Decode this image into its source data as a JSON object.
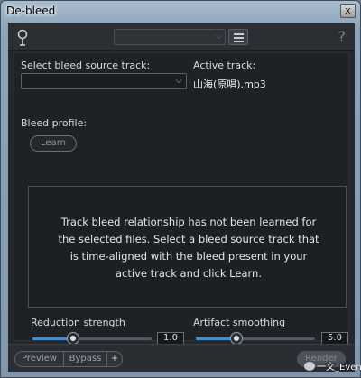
{
  "window": {
    "title": "De-bleed",
    "close_glyph": "x"
  },
  "topbar": {
    "plugin_icon": "microphone-icon",
    "preset_value": "",
    "menu_icon": "hamburger-icon",
    "help_glyph": "?"
  },
  "source": {
    "label": "Select bleed source track:",
    "value": ""
  },
  "active": {
    "label": "Active track:",
    "value": "山海(原唱).mp3"
  },
  "profile": {
    "label": "Bleed profile:",
    "learn_label": "Learn"
  },
  "info": {
    "message": "Track bleed relationship has not been learned for the selected files. Select a bleed source track that is time-aligned with the bleed present in your active track and click Learn."
  },
  "reduction": {
    "label": "Reduction strength",
    "value": "1.0",
    "level": 0.34
  },
  "artifact": {
    "label": "Artifact smoothing",
    "value": "5.0",
    "level": 0.34
  },
  "bottombar": {
    "preview_label": "Preview",
    "bypass_label": "Bypass",
    "add_label": "+",
    "render_label": "Render"
  },
  "watermark": {
    "text": "一文_Even"
  },
  "colors": {
    "accent": "#3a8fe0",
    "panel": "#1e2125",
    "background": "#24272c"
  }
}
